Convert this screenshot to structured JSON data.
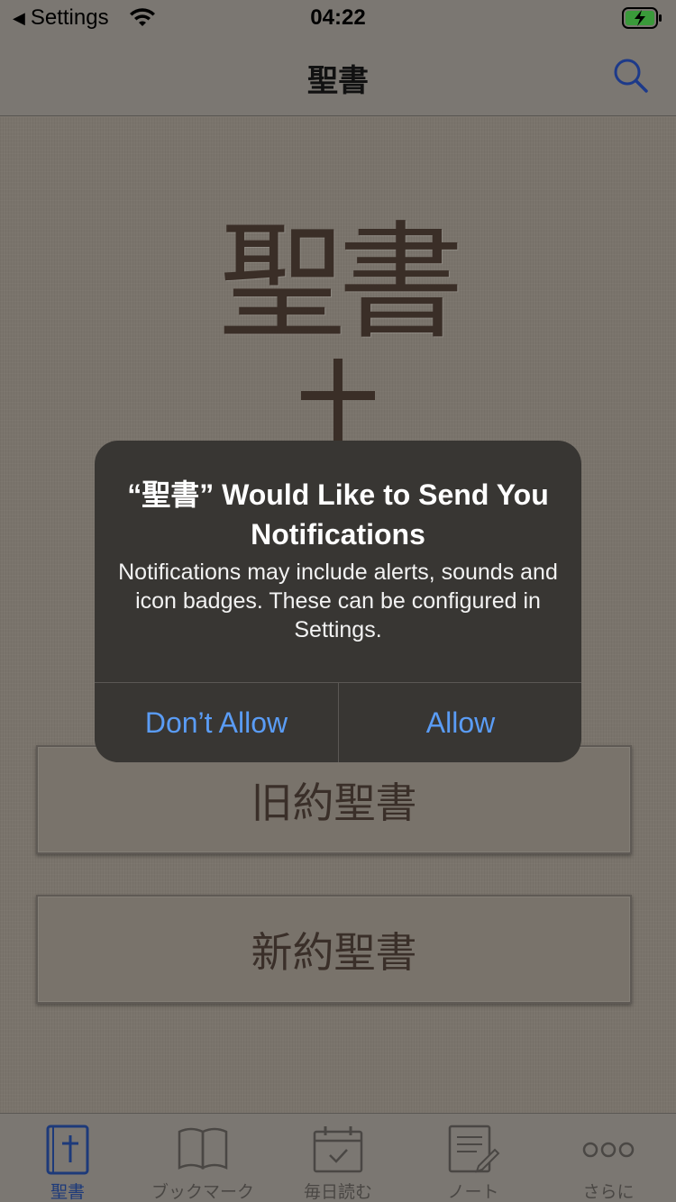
{
  "status_bar": {
    "back_app": "Settings",
    "time": "04:22"
  },
  "nav": {
    "title": "聖書",
    "search_icon": "search-icon"
  },
  "main": {
    "hero_title": "聖書",
    "cross_icon": "cross-icon",
    "old_testament": "旧約聖書",
    "new_testament": "新約聖書"
  },
  "alert": {
    "title": "“聖書” Would Like to Send You Notifications",
    "message": "Notifications may include alerts, sounds and icon badges. These can be configured in Settings.",
    "deny_label": "Don’t Allow",
    "allow_label": "Allow",
    "button_color": "#5a9cf5"
  },
  "tabs": [
    {
      "label": "聖書",
      "icon": "bible-icon",
      "active": true
    },
    {
      "label": "ブックマーク",
      "icon": "book-open-icon",
      "active": false
    },
    {
      "label": "毎日読む",
      "icon": "calendar-check-icon",
      "active": false
    },
    {
      "label": "ノート",
      "icon": "note-pen-icon",
      "active": false
    },
    {
      "label": "さらに",
      "icon": "more-dots-icon",
      "active": false
    }
  ],
  "colors": {
    "background": "#7a746c",
    "accent_blue": "#1d3a7a",
    "text_brown": "#3a2e27"
  }
}
